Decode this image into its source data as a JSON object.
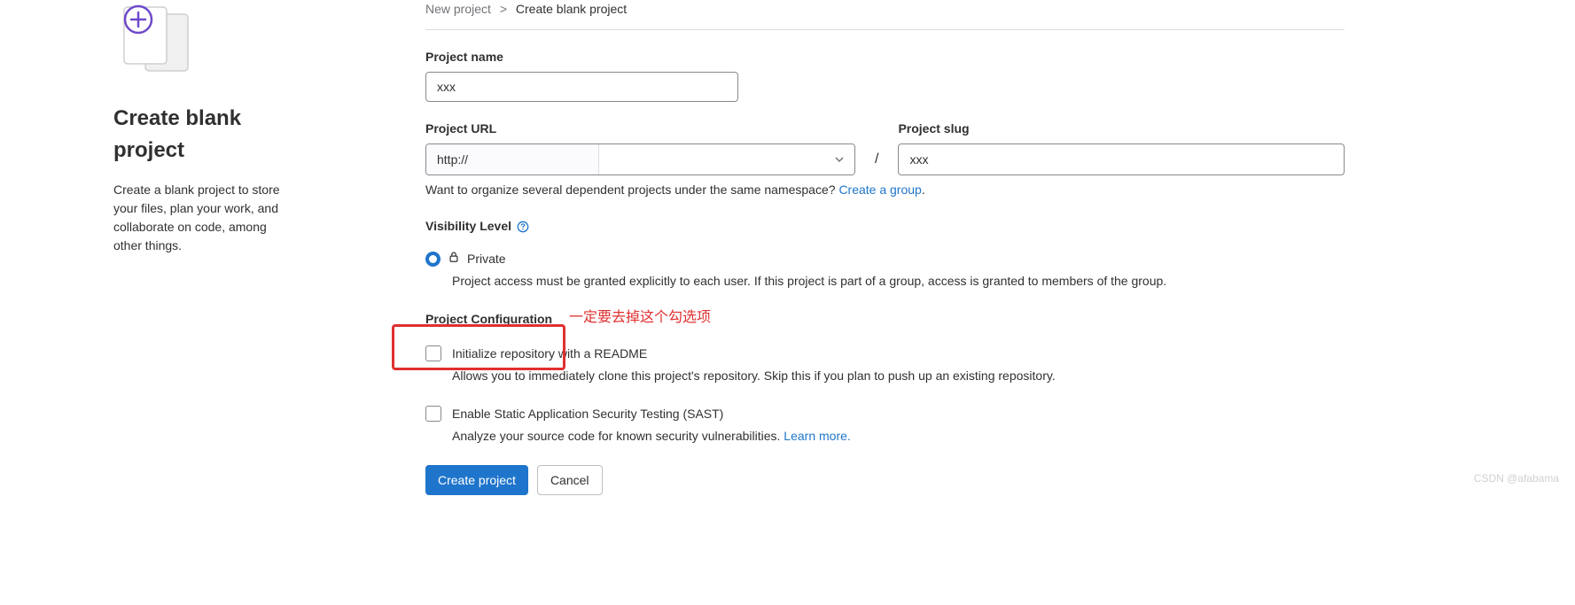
{
  "left": {
    "title": "Create blank project",
    "description": "Create a blank project to store your files, plan your work, and collaborate on code, among other things."
  },
  "breadcrumb": {
    "parent": "New project",
    "sep": ">",
    "current": "Create blank project"
  },
  "projectName": {
    "label": "Project name",
    "value": "xxx"
  },
  "projectUrl": {
    "label": "Project URL",
    "prefix": "http://",
    "selected": ""
  },
  "projectSlug": {
    "label": "Project slug",
    "value": "xxx"
  },
  "slash": "/",
  "namespaceHelp": {
    "text": "Want to organize several dependent projects under the same namespace? ",
    "link": "Create a group"
  },
  "visibility": {
    "label": "Visibility Level",
    "optionLabel": "Private",
    "description": "Project access must be granted explicitly to each user. If this project is part of a group, access is granted to members of the group."
  },
  "config": {
    "label": "Project Configuration",
    "readme": {
      "label": "Initialize repository with a README",
      "description": "Allows you to immediately clone this project's repository. Skip this if you plan to push up an existing repository."
    },
    "sast": {
      "label": "Enable Static Application Security Testing (SAST)",
      "descriptionPrefix": "Analyze your source code for known security vulnerabilities. ",
      "learnMore": "Learn more."
    }
  },
  "buttons": {
    "create": "Create project",
    "cancel": "Cancel"
  },
  "annotation": "一定要去掉这个勾选项",
  "watermark": "CSDN @afabama"
}
